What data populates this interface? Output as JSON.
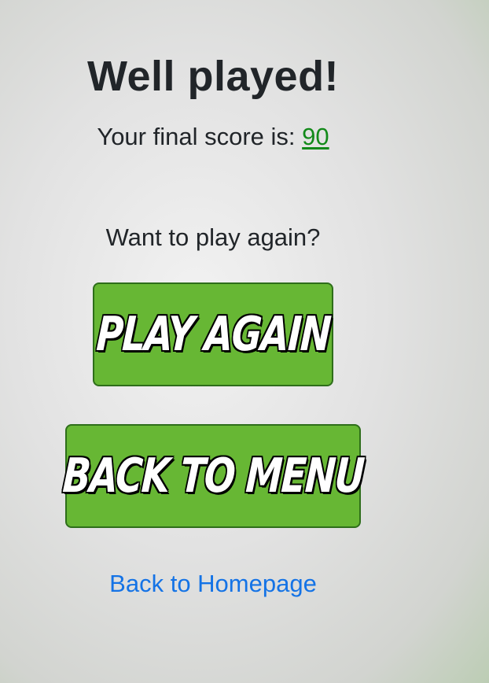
{
  "result": {
    "heading": "Well played!",
    "score_label": "Your final score is:",
    "score_value": "90",
    "score_color": "#138a1a"
  },
  "actions": {
    "prompt": "Want to play again?",
    "play_again_label": "Play again",
    "back_to_menu_label": "Back to menu",
    "homepage_link_label": "Back to Homepage"
  },
  "colors": {
    "button_green": "#67b734",
    "link_blue": "#1473e6"
  }
}
